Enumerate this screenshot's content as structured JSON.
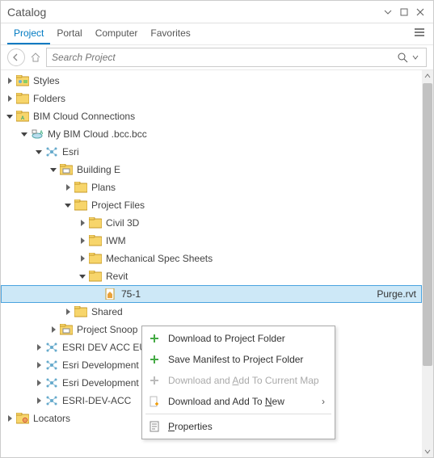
{
  "window": {
    "title": "Catalog"
  },
  "tabs": [
    {
      "label": "Project",
      "active": true
    },
    {
      "label": "Portal",
      "active": false
    },
    {
      "label": "Computer",
      "active": false
    },
    {
      "label": "Favorites",
      "active": false
    }
  ],
  "search": {
    "placeholder": "Search Project"
  },
  "tree": {
    "styles": "Styles",
    "folders": "Folders",
    "bim_cloud": "BIM Cloud Connections",
    "my_bim": "My BIM Cloud .bcc.bcc",
    "esri": "Esri",
    "building_e": "Building E",
    "plans": "Plans",
    "project_files": "Project Files",
    "civil3d": "Civil 3D",
    "iwm": "IWM",
    "mech": "Mechanical Spec Sheets",
    "revit": "Revit",
    "selected_file_left": "75-1",
    "selected_file_right": "Purge.rvt",
    "shared": "Shared",
    "project_snoop": "Project Snoop",
    "esri_dev_acc_eu": "ESRI DEV ACC EU",
    "esri_development1": "Esri Development",
    "esri_development2": "Esri Development",
    "esri_dev_acc": "ESRI-DEV-ACC",
    "locators": "Locators"
  },
  "context_menu": {
    "download_project": "Download to Project Folder",
    "save_manifest": "Save Manifest to Project Folder",
    "download_add_current_pre": "Download and ",
    "download_add_current_mid": "A",
    "download_add_current_post": "dd To Current Map",
    "download_add_new_pre": "Download and Add To ",
    "download_add_new_mid": "N",
    "download_add_new_post": "ew",
    "properties_pre": "",
    "properties_mid": "P",
    "properties_post": "roperties"
  }
}
